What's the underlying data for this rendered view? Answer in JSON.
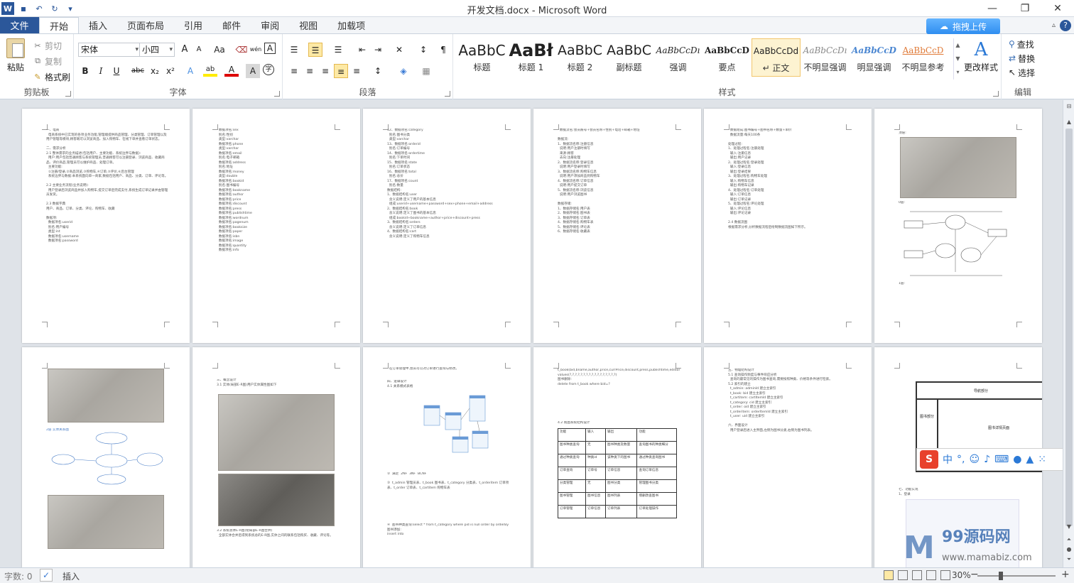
{
  "window": {
    "title": "开发文档.docx - Microsoft Word",
    "minimize": "—",
    "restore": "❐",
    "close": "✕"
  },
  "qat": {
    "word_icon": "W",
    "save_icon": "💾",
    "undo": "↶",
    "redo": "↻",
    "more": "▾"
  },
  "tabs": {
    "file": "文件",
    "items": [
      "开始",
      "插入",
      "页面布局",
      "引用",
      "邮件",
      "审阅",
      "视图",
      "加载项"
    ],
    "active": "开始",
    "upload_btn": "拖拽上传",
    "help": "?"
  },
  "ribbon": {
    "clipboard": {
      "label": "剪贴板",
      "paste": "粘贴",
      "cut": "剪切",
      "copy": "复制",
      "format_painter": "格式刷"
    },
    "font": {
      "label": "字体",
      "font_name": "宋体",
      "font_size": "小四",
      "grow": "A",
      "shrink": "A",
      "case": "Aa",
      "clear": "⌫",
      "phonetic": "wén",
      "border_char": "A",
      "bold": "B",
      "italic": "I",
      "underline": "U",
      "strike": "abc",
      "subscript": "x₂",
      "superscript": "x²",
      "effects": "A",
      "highlight": "ab",
      "font_color": "A",
      "char_shade": "A",
      "enclose": "字"
    },
    "paragraph": {
      "label": "段落",
      "bullets": "☰",
      "numbering": "☰",
      "multilevel": "☰",
      "decrease_indent": "⇤",
      "increase_indent": "⇥",
      "chinese_layout": "✕",
      "sort": "↕",
      "show_marks": "¶",
      "align_left": "≡",
      "align_center": "≡",
      "align_right": "≡",
      "justify": "≡",
      "distributed": "≡",
      "line_spacing": "↕",
      "shading": "◈",
      "borders": "▦"
    },
    "styles": {
      "label": "样式",
      "items": [
        {
          "sample": "AaBbC",
          "name": "标题"
        },
        {
          "sample": "AaBł",
          "name": "标题 1"
        },
        {
          "sample": "AaBbC",
          "name": "标题 2"
        },
        {
          "sample": "AaBbC",
          "name": "副标题"
        },
        {
          "sample": "AaBbCcDı",
          "name": "强调"
        },
        {
          "sample": "AaBbCcD",
          "name": "要点"
        },
        {
          "sample": "AaBbCcDd",
          "name": "↵ 正文"
        },
        {
          "sample": "AaBbCcDı",
          "name": "不明显强调"
        },
        {
          "sample": "AaBbCcD",
          "name": "明显强调"
        },
        {
          "sample": "AaBbCcD",
          "name": "不明显参考"
        }
      ],
      "change_styles": "更改样式"
    },
    "editing": {
      "label": "编辑",
      "find": "查找",
      "replace": "替换",
      "select": "选择"
    }
  },
  "pages": {
    "p1_text": "一、电商\n  电商系统中已实现的各项业务功能,管理端提供商品管理、分类管理、订单管理以及用户管理等模块,顾客端可以浏览商品、加入购物车、在线下单并查看订单状态。\n\n二、需求分析\n2.1 整体需求的业务描述(包括用户、主要功能、系统边界与数据):\n  用户:用户包括普通顾客与系统管理员,普通顾客可以注册登录、浏览商品、收藏商品、评价商品,管理员可以维护商品、处理订单。\n  主要功能:\n  ①注册/登录,②商品浏览,③购物车,④订单,⑤评价,⑥后台管理\n  系统边界与数据:本系统面向单一商家,数据包括用户、商品、分类、订单、评论等。\n\n2.2 主要业务流程(业务说明):\n  用户登录后浏览商品并加入购物车,提交订单后完成支付,系统生成订单记录并由管理员发货。\n\n2.3 数据字典\n用户、商品、订单、分类、评论、购物车、收藏\n\n数据项:\n  数据项名:userid\n  别名:用户编号\n  类型:int\n  数据项名:username\n  数据项名:password",
    "p2_text": "  数据项名:sex\n  别名:性别\n  类型:varchar\n  数据项名:phone\n  类型:varchar\n  数据项名:email\n  别名:电子邮箱\n  数据项名:address\n  别名:地址\n  数据项名:money\n  类型:double\n  数据项名:bookid\n  别名:图书编号\n  数据项名:bookname\n  数据项名:author\n  数据项名:price\n  数据项名:discount\n  数据项名:press\n  数据项名:publishtime\n  数据项名:wordnum\n  数据项名:pagenum\n  数据项名:booksize\n  数据项名:paper\n  数据项名:isbn\n  数据项名:image\n  数据项名:quantity\n  数据项名:info",
    "p3_text": "12、数据项名:category\n  别名:图书分类\n  类型:varchar\n13、数据项名:orderid\n  别名:订单编号\n14、数据项名:ordertime\n  别名:下单时间\n15、数据项名:state\n  别名:订单状态\n16、数据项名:total\n  别名:总价\n17、数据项名:count\n  别名:数量\n数据结构:\n1、数据结构名:user\n  含义说明:定义了用户的基本信息\n  组成:userid+username+password+sex+phone+email+address\n2、数据结构名:book\n  含义说明:定义了图书的基本信息\n  组成:bookid+bookname+author+price+discount+press\n3、数据结构名:orders\n  含义说明:定义了订单信息\n4、数据结构名:cart\n  含义说明:定义了购物车信息",
    "p4_text": "  数据流名:会员账号+会员名称+性别+电话+邮箱+地址\n\n数据流:\n1、数据流名称:注册信息\n  说明:用户注册时填写\n  来源:顾客\n  去向:注册处理\n2、数据流名称:登录信息\n  说明:用户登录时填写\n3、数据流名称:购物车信息\n  说明:用户添加商品到购物车\n4、数据流名称:订单信息\n  说明:用户提交订单\n5、数据流名称:浏览信息\n  说明:用户浏览图书\n\n数据存储:\n1、数据存储名:用户表\n2、数据存储名:图书表\n3、数据存储名:订单表\n4、数据存储名:购物车表\n5、数据存储名:评论表\n6、数据存储名:收藏表",
    "p5_text": "  数据组成:图书编号+图书名称+数量+单价\n  数据流量:每天100条\n\n处理过程:\n1、处理过程名:注册处理\n  输入:注册信息\n  输出:用户记录\n2、处理过程名:登录处理\n  输入:登录信息\n  输出:登录结果\n3、处理过程名:购物车处理\n  输入:购物车信息\n  输出:购物车记录\n4、处理过程名:订单处理\n  输入:订单信息\n  输出:订单记录\n5、处理过程名:评论处理\n  输入:评论信息\n  输出:评论记录\n\n2.4 数据流图\n根据需求分析,分析数据流程后绘制数据流图如下所示。",
    "p6_caption1": "顶层:",
    "p6_caption2": "0层:",
    "p6_caption3": "1层:",
    "p7_caption": "2层 实体关系图",
    "p8_text1": "三、概念设计\n3.1 实体(局部E-R图)用户实体属性图如下",
    "p8_text2": "3.2 系统总体E-R图(把局部E-R图合并)\n  全部实体合并后得到系统总的E-R图,实体之间的联系包括购买、收藏、评论等。",
    "p9_text1": "  在订单管理中,会员可以对订单进行查询与修改。",
    "p9_text2": "四、逻辑设计\n4.1 关系模式表格",
    "p9_text3": "②  满足  2NF  3NF  BCNF\n\n③  t_admin 管理员表、t_book 图书表、t_category 分类表、t_orderitem 订单项表、t_order 订单表、t_cartitem 购物车表",
    "p9_text4": "④  图书种类查询:select * from t_category where pid is null order by orderBy\n图书添加:\ninsert into",
    "p10_text1": "t_book(bid,bname,author,price,currPrice,discount,press,publishtime,edition,pageNum,wordNum,printtime,booksize,paper,cid,image_w,image_b)\nvalues(?,?,?,?,?,?,?,?,?,?,?,?,?,?,?,?,?)\n图书删除:\ndelete from t_book where bid=?",
    "p10_text2": "4.2 视图系统结构设计",
    "p10_table": [
      [
        "功能",
        "输入",
        "输出",
        "功能"
      ],
      [
        "图书种类查询",
        "无",
        "图书种类及数量",
        "查询图书的种类细分"
      ],
      [
        "通过种类查询",
        "种类id",
        "该种类下的图书",
        "通过种类查询图书"
      ],
      [
        "订单查询",
        "订单号",
        "订单信息",
        "查询订单信息"
      ],
      [
        "分类管理",
        "无",
        "图书分类",
        "管理图书分类"
      ],
      [
        "图书管理",
        "图书信息",
        "图书列表",
        "增删改查图书"
      ],
      [
        "订单管理",
        "订单信息",
        "订单列表",
        "订单处理操作"
      ]
    ],
    "p11_text": "五、物理结构设计\n5.1 查询操作频度与事件响应分析\n  查询的最常见的操作为图书查询,需要按照种类、价格等条件进行检索。\n5.2 索引的建立\n  t_admin: adminId 建立主索引\n  t_book: bid 建立主索引\n  t_cartitem: cartItemId 建立主索引\n  t_category: cid 建立主索引\n  t_order: oid 建立主索引\n  t_orderitem: orderItemId 建立主索引\n  t_user: uid 建立主索引\n\n六、界面设计\n  用户登录后进入主界面,左侧为图书分类,右侧为图书列表。",
    "p12_header1": "导航部分",
    "p12_header2": "图书部分",
    "p12_header3": "图书详情页面",
    "p12_caption": "七、功能实现\n1、登录"
  },
  "ime": {
    "logo": "S",
    "lang": "中",
    "punct": "°,",
    "emoji": "☺",
    "mic": "🎤",
    "keyboard": "⌨",
    "user": "👤",
    "skin": "👕",
    "grid": "⁙"
  },
  "watermark": {
    "text": "99源码网",
    "sub": "www.mamabiz.com"
  },
  "status": {
    "words": "字数: 0",
    "proof_icon": "✓",
    "mode": "插入",
    "zoom": "30%",
    "zoom_out": "−",
    "zoom_in": "+"
  }
}
